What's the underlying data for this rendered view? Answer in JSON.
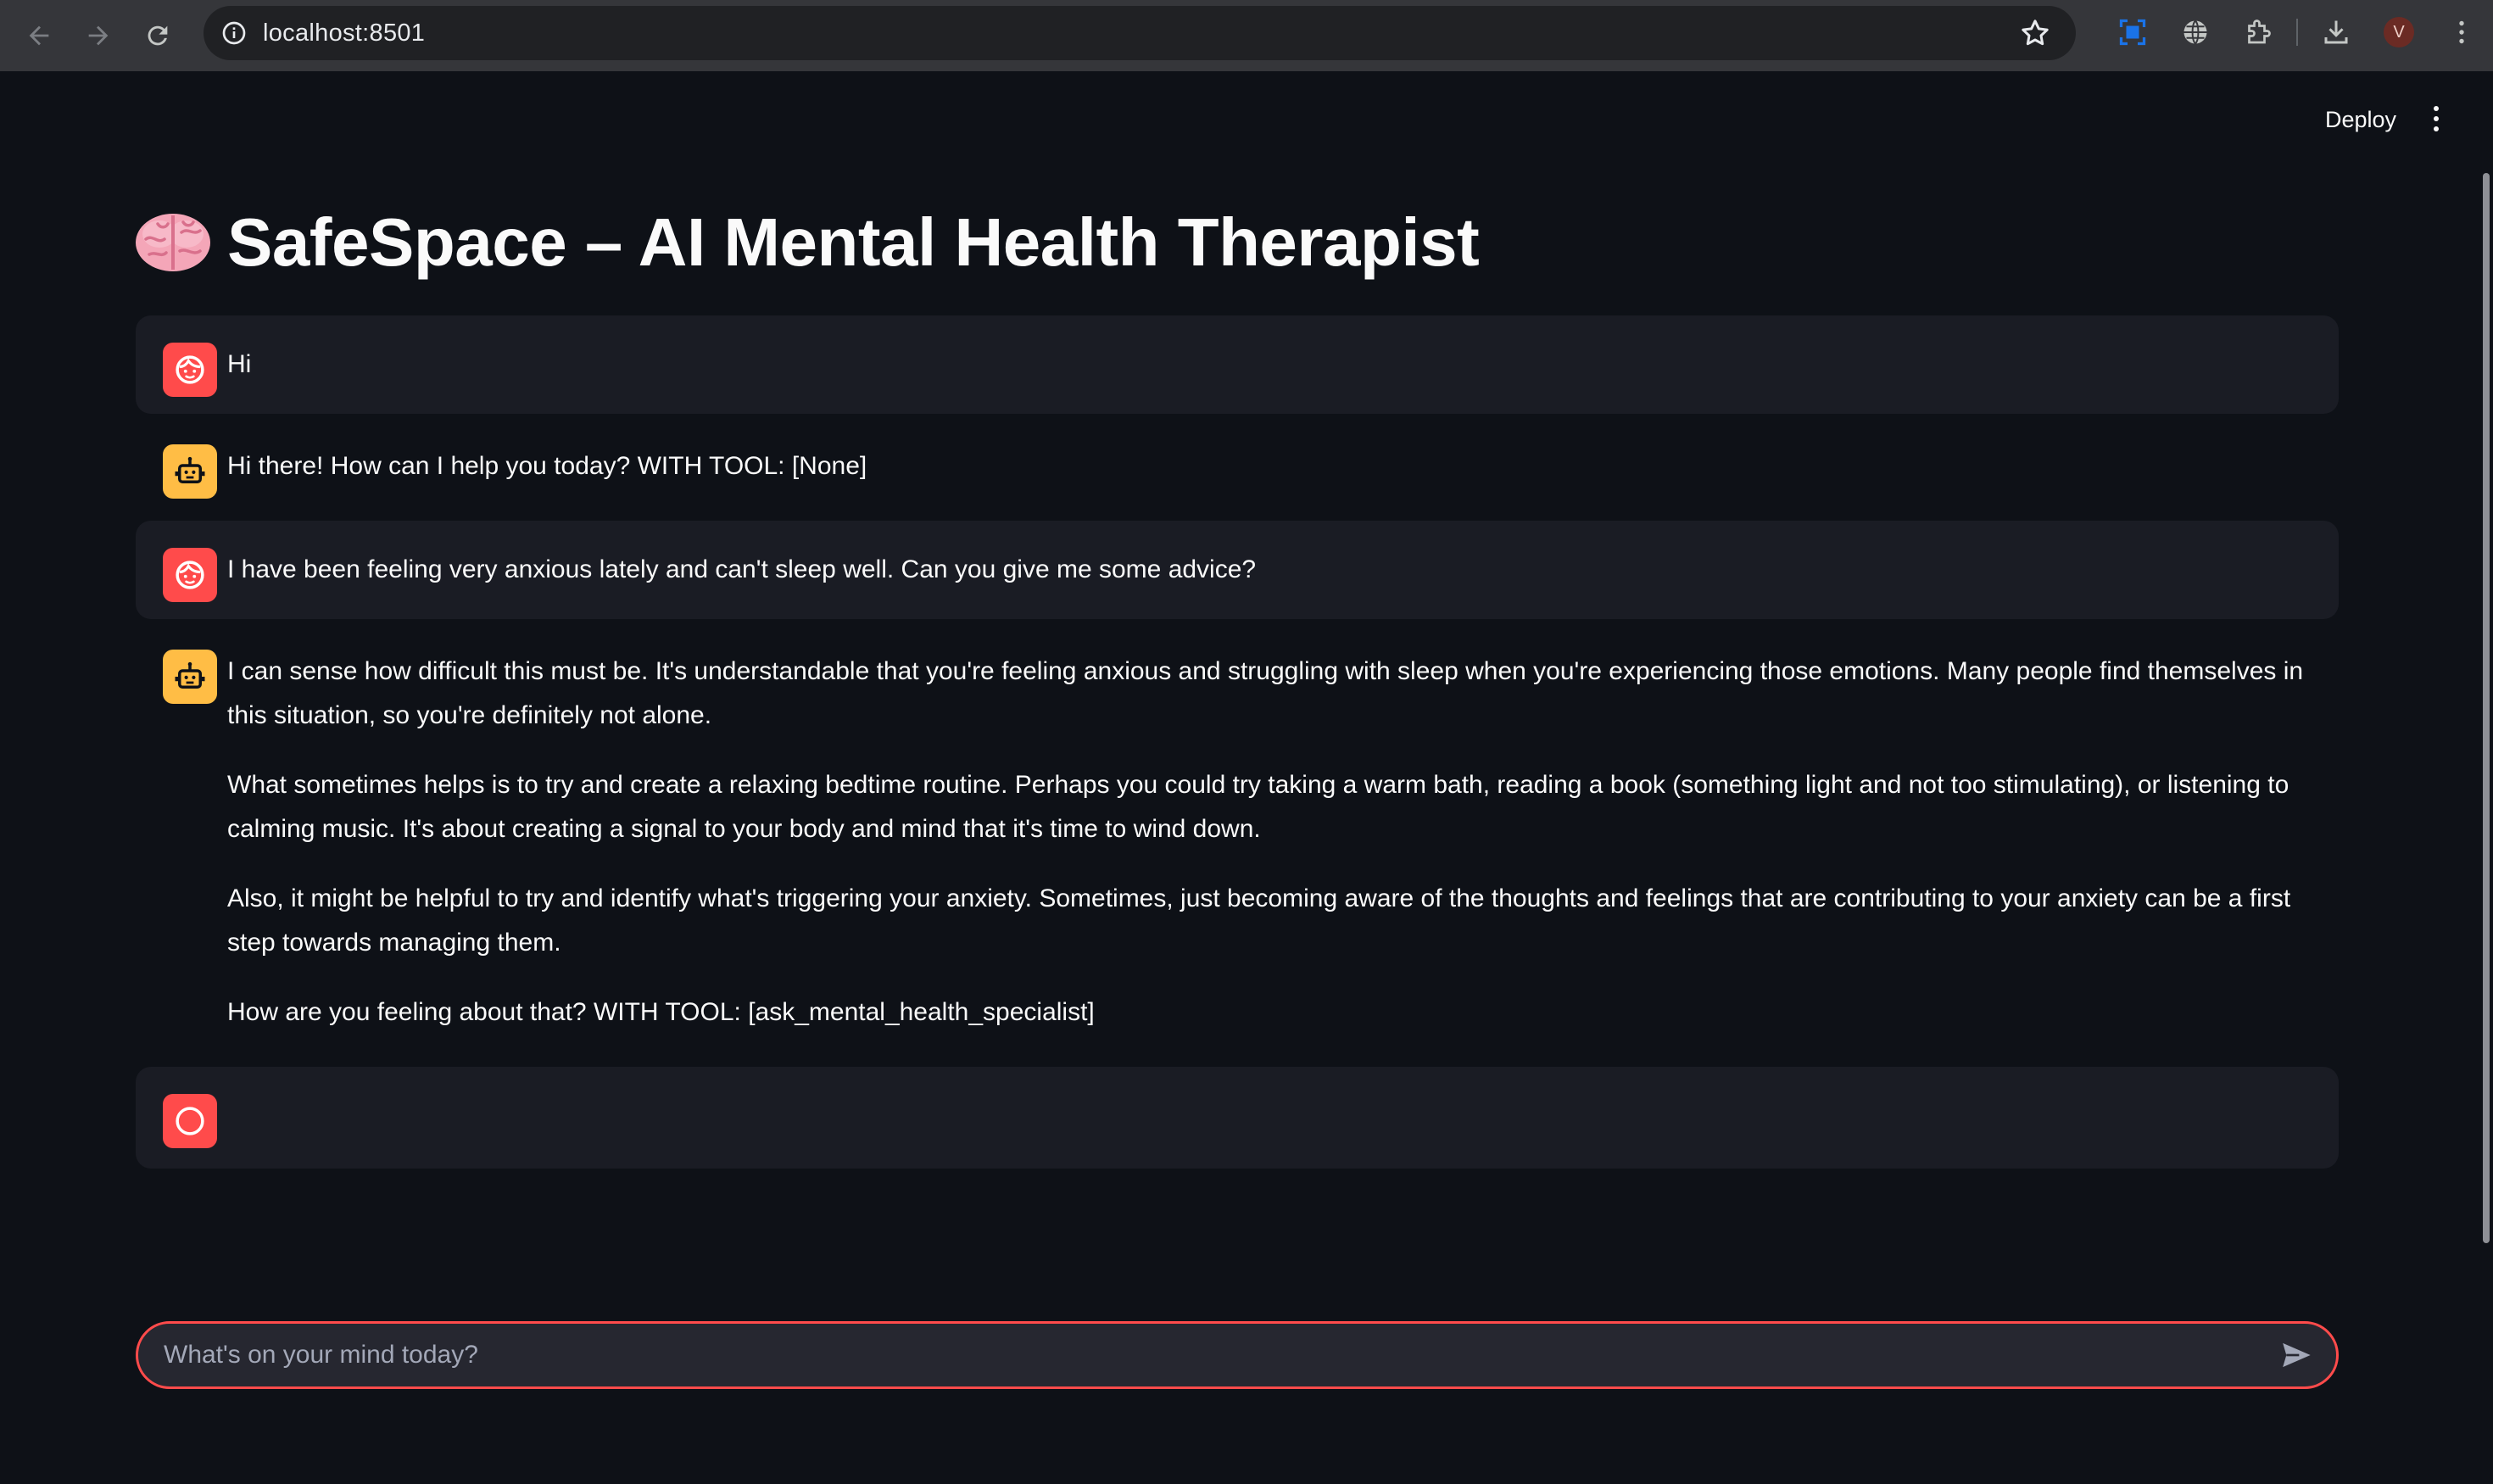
{
  "browser": {
    "url": "localhost:8501",
    "profile_initial": "V",
    "icons": [
      "back-arrow-icon",
      "forward-arrow-icon",
      "reload-icon",
      "site-info-icon",
      "bookmark-star-icon",
      "screen-capture-icon",
      "globe-icon",
      "extensions-icon",
      "download-icon",
      "menu-dots-icon"
    ]
  },
  "header": {
    "deploy_label": "Deploy"
  },
  "page": {
    "title": "SafeSpace – AI Mental Health Therapist",
    "title_icon": "brain-emoji-icon"
  },
  "chat": {
    "messages": [
      {
        "role": "user",
        "paragraphs": [
          "Hi"
        ]
      },
      {
        "role": "assistant",
        "paragraphs": [
          "Hi there! How can I help you today? WITH TOOL: [None]"
        ]
      },
      {
        "role": "user",
        "paragraphs": [
          "I have been feeling very anxious lately and can't sleep well. Can you give me some advice?"
        ]
      },
      {
        "role": "assistant",
        "paragraphs": [
          "I can sense how difficult this must be. It's understandable that you're feeling anxious and struggling with sleep when you're experiencing those emotions. Many people find themselves in this situation, so you're definitely not alone.",
          "What sometimes helps is to try and create a relaxing bedtime routine. Perhaps you could try taking a warm bath, reading a book (something light and not too stimulating), or listening to calming music. It's about creating a signal to your body and mind that it's time to wind down.",
          "Also, it might be helpful to try and identify what's triggering your anxiety. Sometimes, just becoming aware of the thoughts and feelings that are contributing to your anxiety can be a first step towards managing them.",
          "How are you feeling about that? WITH TOOL: [ask_mental_health_specialist]"
        ]
      },
      {
        "role": "user",
        "paragraphs": [
          ""
        ]
      }
    ]
  },
  "input": {
    "placeholder": "What's on your mind today?"
  },
  "colors": {
    "background": "#0e1117",
    "user_avatar": "#ff4b4b",
    "assistant_avatar": "#ffbd45",
    "input_border": "#ff4b4b"
  }
}
